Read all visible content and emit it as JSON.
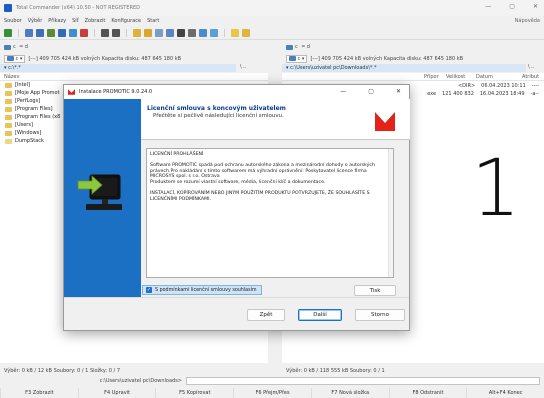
{
  "tc": {
    "title": "Total Commander (x64) 10.50 - NOT REGISTERED",
    "window_controls": [
      "—",
      "▢",
      "✕"
    ],
    "menu": [
      "Soubor",
      "Výběr",
      "Příkazy",
      "Síť",
      "Zobrazit",
      "Konfigurace",
      "Start"
    ],
    "menu_help": "Nápověda",
    "left": {
      "drive_c": "c",
      "drive_d": "d",
      "info": "[---]  409 705 424 kB volných  Kapacita disku: 487 645 180 kB",
      "path": "▾ c:\\*.*",
      "path_right": "\\  ..",
      "col_name": "Název",
      "files": [
        "[Intel]",
        "[Moje App Promot",
        "[PerfLogs]",
        "[Program Files]",
        "[Program Files (x8",
        "[Users]",
        "[Windows]",
        "DumpStack"
      ],
      "status": "Výběr: 0 kB / 12 kB  Soubory: 0 / 1  Složky: 0 / 7"
    },
    "right": {
      "drive_c": "c",
      "drive_d": "d",
      "info": "[---]  409 705 424 kB volných  Kapacita disku: 487 645 180 kB",
      "path": "▾ c:\\Users\\uzivatel pc\\Downloads\\*.*",
      "path_right": "\\  ..",
      "cols": [
        "Přípor",
        "Velikost",
        "Datum",
        "Atribut"
      ],
      "rows": [
        {
          "ext": "",
          "size": "<DIR>",
          "date": "06.04.2023 10:11",
          "attr": "----"
        },
        {
          "ext": "exe",
          "size": "121 400 832",
          "date": "16.04.2023 18:49",
          "attr": "-a--"
        }
      ],
      "status": "Výběr: 0 kB / 118 555 kB  Soubory: 0 / 1"
    },
    "cmd_label": "c:\\Users\\uzivatel pc\\Downloads>",
    "fkeys": [
      "F3 Zobrazit",
      "F4 Upravit",
      "F5 Kopírovat",
      "F6 Přejm/Přes",
      "F7 Nová složka",
      "F8 Odstranit",
      "Alt+F4 Konec"
    ]
  },
  "dialog": {
    "title": "Instalace PROMOTIC 9.0.24.0",
    "header_title": "Licenční smlouva s koncovým uživatelem",
    "header_sub": "Přečtěte si pečlivě následující licenční smlouvu.",
    "license_p1": "LICENČNÍ PROHLÁŠENÍ",
    "license_p2": "Software PROMOTIC spadá pod ochranu autorského zákona a mezinárodní dohody o autorských právech.Pro nakládání s tímto softwarem má výhradní oprávnění: Poskytovatel licence firma MICROSYS spol. s r.o. Ostrava",
    "license_p3": "Produktem se rozumí vlastní software, média, licenční klíč a dokumentace.",
    "license_p4": "INSTALACÍ, KOPÍROVÁNÍM NEBO JINÝM POUŽITÍM PRODUKTU POTVRZUJETE, ŽE SOUHLASÍTE S LICENČNÍMI PODMÍNKAMI.",
    "agree_label": "S podmínkami licenční smlouvy souhlasím",
    "print_btn": "Tisk",
    "back_btn": "Zpět",
    "next_btn": "Další",
    "cancel_btn": "Storno"
  },
  "step_number": "1",
  "colors": {
    "brand_red": "#e2231a",
    "side_blue": "#1c70c4",
    "header_blue": "#0b3b8f"
  }
}
